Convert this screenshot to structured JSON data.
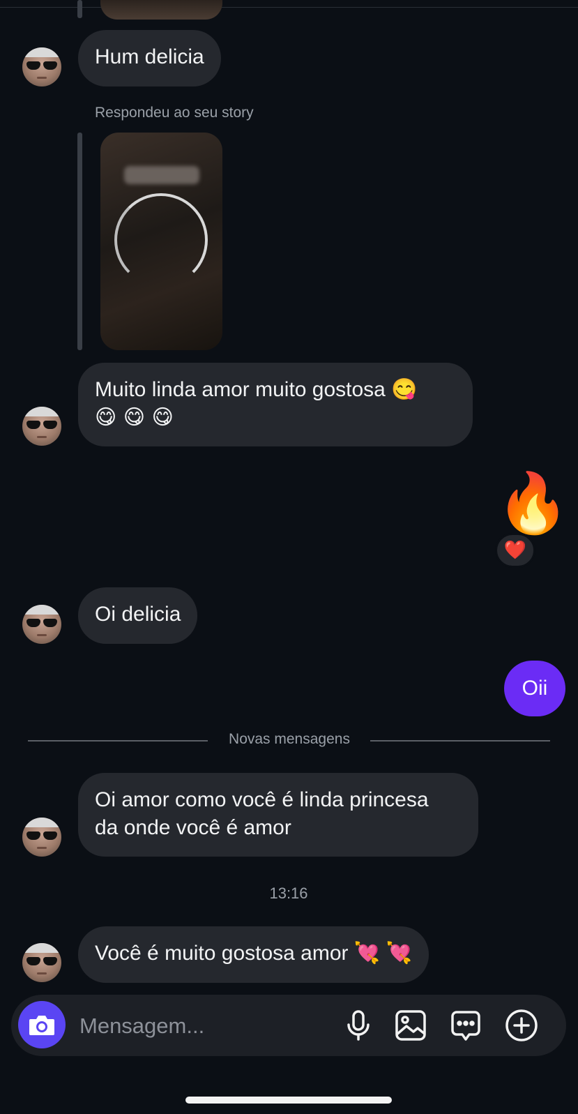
{
  "conversation": {
    "messages": [
      {
        "from": "them",
        "text": "Hum delicia"
      },
      {
        "from": "them",
        "label": "Respondeu ao seu story"
      },
      {
        "from": "them",
        "line1": "Muito linda amor muito gostosa 😋",
        "line2": "😋 😋 😋"
      },
      {
        "from": "me",
        "emoji": "🔥",
        "reaction": "❤️"
      },
      {
        "from": "them",
        "text": "Oi delicia"
      },
      {
        "from": "me",
        "text": "Oii"
      },
      {
        "from": "them",
        "line1": "Oi amor como você é linda princesa",
        "line2": "da onde você é amor"
      },
      {
        "from": "them",
        "text": "Você é muito gostosa amor 💘 💘"
      }
    ],
    "new_messages_divider": "Novas mensagens",
    "timestamp": "13:16"
  },
  "composer": {
    "placeholder": "Mensagem...",
    "icons": [
      "camera-icon",
      "microphone-icon",
      "gallery-icon",
      "sticker-chat-icon",
      "plus-icon"
    ],
    "accent_color": "#5a45f3",
    "sent_bubble_color": "#6b2cf5"
  }
}
